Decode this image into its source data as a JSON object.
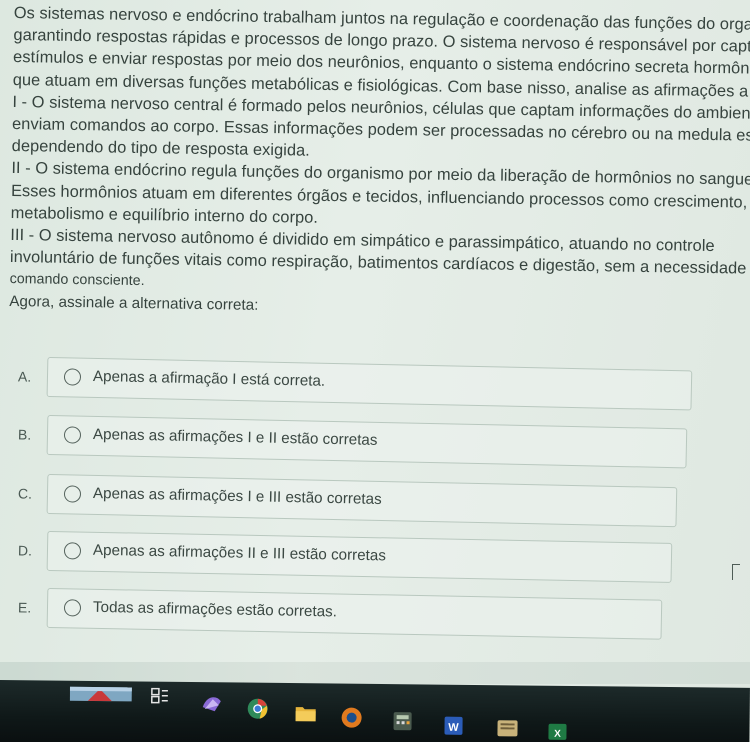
{
  "question": {
    "lines": [
      "Os sistemas nervoso e endócrino trabalham juntos na regulação e coordenação das funções do organism",
      "garantindo respostas rápidas e processos de longo prazo. O sistema nervoso é responsável por captar",
      "estímulos e enviar respostas por meio dos neurônios, enquanto o sistema endócrino secreta hormônios",
      "que atuam em diversas funções metabólicas e fisiológicas. Com base nisso, analise as afirmações a seguir",
      "I - O sistema nervoso central é formado pelos neurônios, células que captam informações do ambiente e",
      "enviam comandos ao corpo. Essas informações podem ser processadas no cérebro ou na medula espinhal,",
      "dependendo do tipo de resposta exigida.",
      "II - O sistema endócrino regula funções do organismo por meio da liberação de hormônios no sangue.",
      "Esses hormônios atuam em diferentes órgãos e tecidos, influenciando processos como crescimento,",
      "metabolismo e equilíbrio interno do corpo.",
      "III - O sistema nervoso autônomo é dividido em simpático e parassimpático, atuando no controle",
      "involuntário de funções vitais como respiração, batimentos cardíacos e digestão, sem a necessidade de",
      "comando consciente.",
      "Agora, assinale a alternativa correta:"
    ]
  },
  "options": [
    {
      "letter": "A.",
      "text": "Apenas a afirmação I está correta."
    },
    {
      "letter": "B.",
      "text": "Apenas as afirmações I e II estão corretas"
    },
    {
      "letter": "C.",
      "text": "Apenas as afirmações I e III estão corretas"
    },
    {
      "letter": "D.",
      "text": "Apenas as afirmações II e III estão corretas"
    },
    {
      "letter": "E.",
      "text": "Todas as afirmações estão corretas."
    }
  ],
  "taskbar": {
    "icons": [
      "thumbnail-icon",
      "task-view-icon",
      "app-icon",
      "chrome-icon",
      "folder-icon",
      "app-icon-2",
      "calculator-icon",
      "word-icon",
      "notes-icon",
      "excel-icon"
    ]
  }
}
